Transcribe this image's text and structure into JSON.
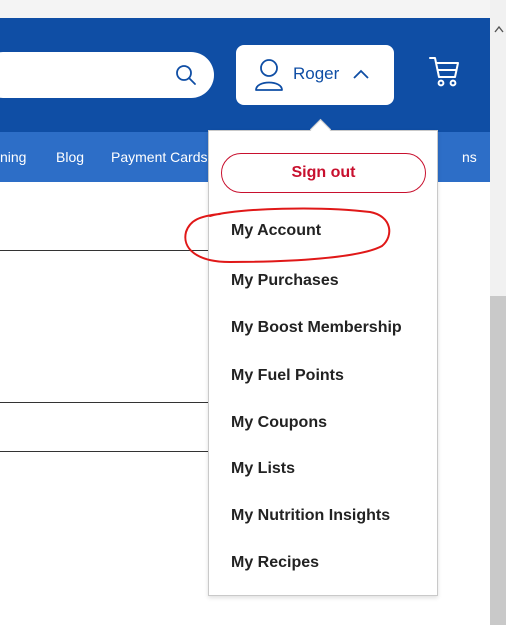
{
  "header": {
    "user": {
      "name": "Roger"
    }
  },
  "icons": {
    "search": "search-icon",
    "user": "user-icon",
    "chevron": "chevron-up-icon",
    "cart": "cart-icon"
  },
  "nav": {
    "items": [
      "ning",
      "Blog",
      "Payment Cards",
      "ns"
    ]
  },
  "account_menu": {
    "sign_out": "Sign out",
    "items": [
      "My Account",
      "My Purchases",
      "My Boost Membership",
      "My Fuel Points",
      "My Coupons",
      "My Lists",
      "My Nutrition Insights",
      "My Recipes"
    ]
  },
  "colors": {
    "header_blue": "#0f4ea5",
    "nav_blue": "#2d6ec7",
    "sign_out_red": "#c8102e",
    "annotation_red": "#e01818"
  }
}
